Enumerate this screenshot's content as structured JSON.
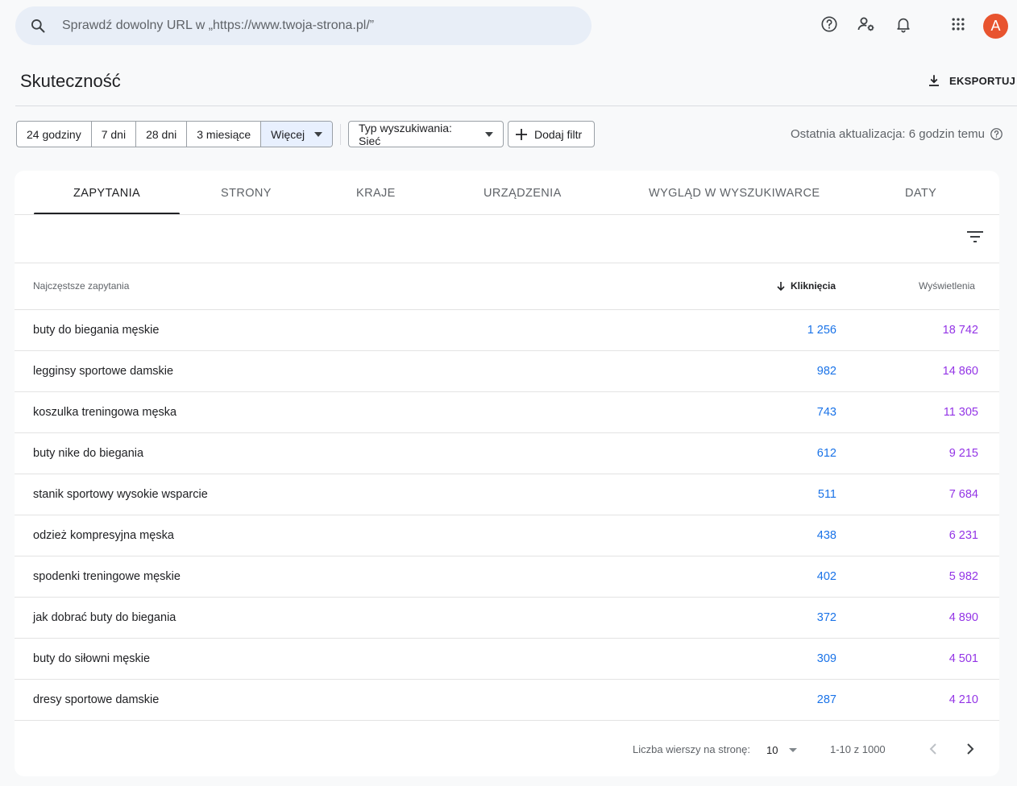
{
  "search": {
    "placeholder": "Sprawdź dowolny URL w „https://www.twoja-strona.pl/”"
  },
  "topbar": {
    "icons": [
      "help-icon",
      "user-settings-icon",
      "notifications-icon",
      "apps-grid-icon"
    ],
    "avatar_letter": "A",
    "avatar_color": "#e8542f"
  },
  "header": {
    "title": "Skuteczność",
    "export_label": "EKSPORTUJ"
  },
  "filters": {
    "ranges": [
      "24 godziny",
      "7 dni",
      "28 dni",
      "3 miesiące",
      "Więcej"
    ],
    "search_type": "Typ wyszukiwania: Sieć",
    "add_filter": "Dodaj filtr",
    "last_update": "Ostatnia aktualizacja: 6 godzin temu"
  },
  "tabs": [
    "ZAPYTANIA",
    "STRONY",
    "KRAJE",
    "URZĄDZENIA",
    "WYGLĄD W WYSZUKIWARCE",
    "DATY"
  ],
  "active_tab": "ZAPYTANIA",
  "table": {
    "headers": {
      "query": "Najczęstsze zapytania",
      "clicks": "Kliknięcia",
      "impressions": "Wyświetlenia"
    },
    "rows": [
      {
        "query": "buty do biegania męskie",
        "clicks": "1 256",
        "impressions": "18 742"
      },
      {
        "query": "legginsy sportowe damskie",
        "clicks": "982",
        "impressions": "14 860"
      },
      {
        "query": "koszulka treningowa męska",
        "clicks": "743",
        "impressions": "11 305"
      },
      {
        "query": "buty nike do biegania",
        "clicks": "612",
        "impressions": "9 215"
      },
      {
        "query": "stanik sportowy wysokie wsparcie",
        "clicks": "511",
        "impressions": "7 684"
      },
      {
        "query": "odzież kompresyjna męska",
        "clicks": "438",
        "impressions": "6 231"
      },
      {
        "query": "spodenki treningowe męskie",
        "clicks": "402",
        "impressions": "5 982"
      },
      {
        "query": "jak dobrać buty do biegania",
        "clicks": "372",
        "impressions": "4 890"
      },
      {
        "query": "buty do siłowni męskie",
        "clicks": "309",
        "impressions": "4 501"
      },
      {
        "query": "dresy sportowe damskie",
        "clicks": "287",
        "impressions": "4 210"
      }
    ]
  },
  "pagination": {
    "rows_label": "Liczba wierszy na stronę:",
    "rows_value": "10",
    "range": "1-10 z 1000"
  },
  "colors": {
    "clicks": "#1a73e8",
    "impressions": "#9334e6",
    "search_bg": "#e8eef7",
    "selected_range_bg": "#e8f0fe"
  }
}
